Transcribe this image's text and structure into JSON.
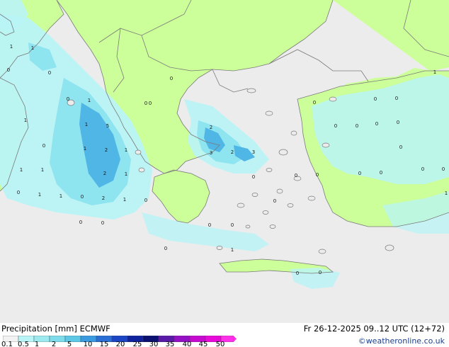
{
  "header": {
    "legend_title": "Precipitation [mm]  ECMWF",
    "valid_time": "Fr 26-12-2025 09..12 UTC (12+72)",
    "credit": "©weatheronline.co.uk"
  },
  "legend": {
    "ticks": [
      "0.1",
      "0.5",
      "1",
      "2",
      "5",
      "10",
      "15",
      "20",
      "25",
      "30",
      "35",
      "40",
      "45",
      "50"
    ],
    "colors": [
      "#f2f2f2",
      "#b9f4f7",
      "#9de9f0",
      "#7ddbea",
      "#5cc8e6",
      "#3b9be0",
      "#2a6fd6",
      "#1b45c4",
      "#0f239e",
      "#0a1170",
      "#5a1aa8",
      "#9410c4",
      "#c60ad0",
      "#e80ad8",
      "#ff30e8"
    ]
  },
  "colors": {
    "sea": "#ececec",
    "land": "#ccff99",
    "border": "#7a7a7a",
    "precip_light": "#b9f4f7",
    "precip_mid": "#8ee4ef",
    "precip_heavy": "#4fb6e6"
  },
  "map_labels": [
    {
      "text": "1"
    },
    {
      "text": "1"
    },
    {
      "text": "0"
    },
    {
      "text": "0"
    },
    {
      "text": "0"
    },
    {
      "text": "1"
    },
    {
      "text": "1"
    },
    {
      "text": "1"
    },
    {
      "text": "5"
    },
    {
      "text": "0"
    },
    {
      "text": "1"
    },
    {
      "text": "2"
    },
    {
      "text": "1"
    },
    {
      "text": "1"
    },
    {
      "text": "1"
    },
    {
      "text": "2"
    },
    {
      "text": "1"
    },
    {
      "text": "0"
    },
    {
      "text": "1"
    },
    {
      "text": "1"
    },
    {
      "text": "0"
    },
    {
      "text": "2"
    },
    {
      "text": "1"
    },
    {
      "text": "0"
    },
    {
      "text": "0"
    },
    {
      "text": "0"
    },
    {
      "text": "0"
    },
    {
      "text": "0"
    },
    {
      "text": "2"
    },
    {
      "text": "3"
    },
    {
      "text": "2"
    },
    {
      "text": "3"
    },
    {
      "text": "0"
    },
    {
      "text": "0"
    },
    {
      "text": "0"
    },
    {
      "text": "0"
    },
    {
      "text": "0"
    },
    {
      "text": "0"
    },
    {
      "text": "0"
    },
    {
      "text": "0"
    },
    {
      "text": "0"
    },
    {
      "text": "1"
    },
    {
      "text": "0"
    },
    {
      "text": "0"
    },
    {
      "text": "0"
    },
    {
      "text": "0"
    },
    {
      "text": "0"
    },
    {
      "text": "1"
    },
    {
      "text": "0"
    },
    {
      "text": "0"
    },
    {
      "text": "0"
    },
    {
      "text": "0"
    },
    {
      "text": "0"
    },
    {
      "text": "1"
    },
    {
      "text": "0"
    },
    {
      "text": "0"
    },
    {
      "text": "0"
    }
  ]
}
